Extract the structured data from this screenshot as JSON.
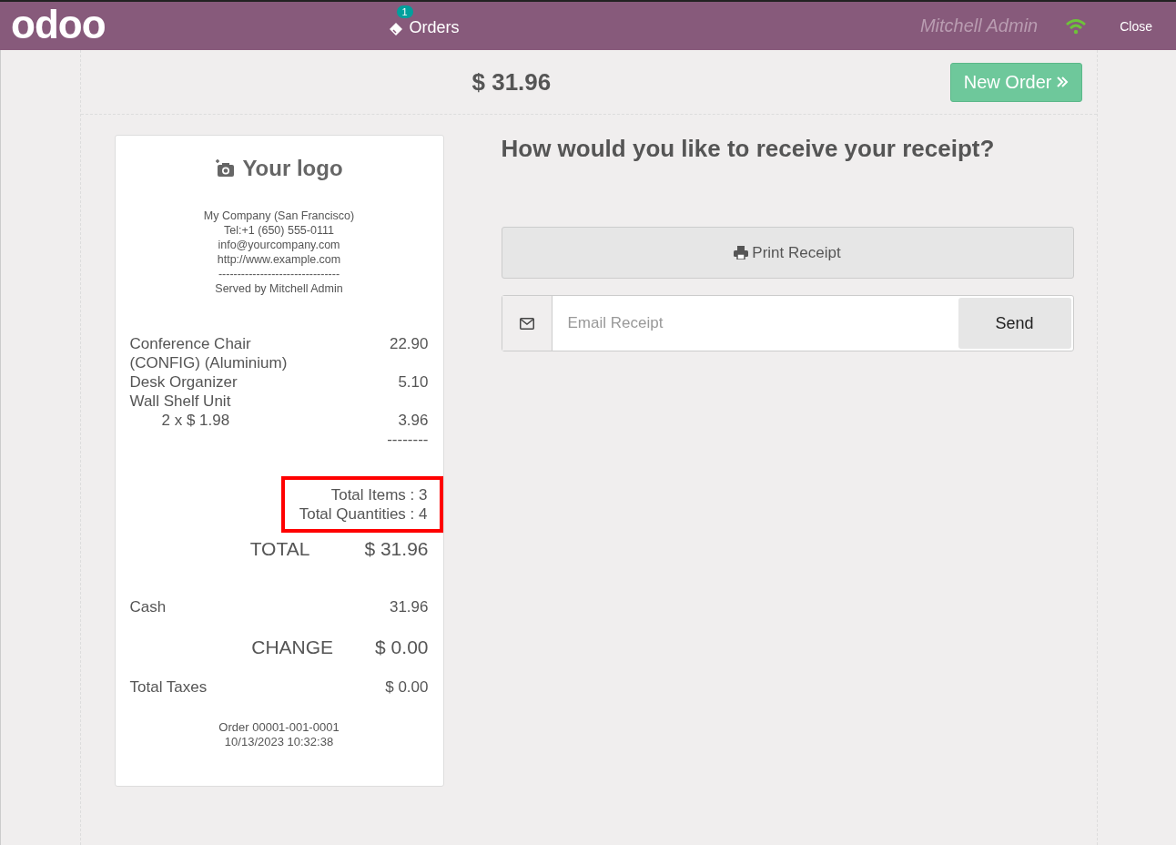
{
  "header": {
    "logo": "odoo",
    "orders_count": "1",
    "orders_label": "Orders",
    "user": "Mitchell Admin",
    "close": "Close"
  },
  "top": {
    "total": "$ 31.96",
    "new_order": "New Order"
  },
  "receipt": {
    "logo_text": "Your logo",
    "company_lines": [
      "My Company (San Francisco)",
      "Tel:+1 (650) 555-0111",
      "info@yourcompany.com",
      "http://www.example.com",
      "--------------------------------",
      "Served by Mitchell Admin"
    ],
    "lines": [
      {
        "name": "Conference Chair",
        "price": "22.90"
      },
      {
        "name": "(CONFIG) (Aluminium)"
      },
      {
        "name": "Desk Organizer",
        "price": "5.10"
      },
      {
        "name": "Wall Shelf Unit"
      },
      {
        "detail": "2 x $ 1.98",
        "price": "3.96"
      }
    ],
    "separator": "--------",
    "summary": {
      "highlighted": true,
      "lines": [
        "Total Items : 3",
        "Total Quantities : 4"
      ]
    },
    "total_label": "TOTAL",
    "total_value": "$ 31.96",
    "payments": [
      {
        "name": "Cash",
        "amount": "31.96"
      }
    ],
    "change_label": "CHANGE",
    "change_value": "$ 0.00",
    "taxes_label": "Total Taxes",
    "taxes_value": "$ 0.00",
    "footer": [
      "Order 00001-001-0001",
      "10/13/2023 10:32:38"
    ]
  },
  "panel": {
    "question": "How would you like to receive your receipt?",
    "print_button": "Print Receipt",
    "email_placeholder": "Email Receipt",
    "send_button": "Send"
  }
}
